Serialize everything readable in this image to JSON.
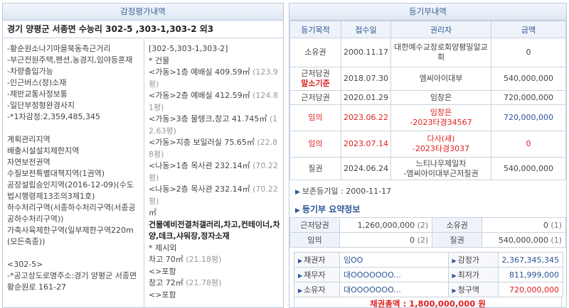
{
  "appraisal": {
    "header": "감정평가내역",
    "address": "경기 양평군 서종면 수능리 302-5 ,303-1,303-2 외3",
    "left_lines": [
      "-황순원소나기마을북동측근거리",
      "-부근전원주택,펜션,농경지,임야등혼재",
      "-차량출입가능",
      "-인근버스(정)소재",
      "-제반교통사정보통",
      "-일단부정형완경사지",
      "-*1차감정:2,359,485,345",
      "",
      "계획관리지역",
      "배출시설설치제한지역",
      "자연보전권역",
      "수질보전특별대책지역(1권역)",
      "공장설립승인지역(2016-12-09)(수도법시행령제13조의3제1호)",
      "하수처리구역(서종하수처리구역(서종공공하수처리구역))",
      "가축사육제한구역(일부제한구역220m(모든축종))",
      "",
      "<302-5>",
      "-*공고상도로명주소:경기 양평군 서종면 황순원로 161-27"
    ],
    "right_items": [
      {
        "text": "[302-5,303-1,303-2]",
        "sub": ""
      },
      {
        "text": "* 건물",
        "sub": ""
      },
      {
        "text": "<가동>1층 예배실 409.59㎡",
        "sub": "(123.9평)"
      },
      {
        "text": "<가동>2층 예배실 412.59㎡",
        "sub": "(124.81평)"
      },
      {
        "text": "<가동>3층 물탱크,창고 41.745㎡",
        "sub": "(12.63평)"
      },
      {
        "text": "<가동>지층 보일러실 75.65㎡",
        "sub": "(22.88평)"
      },
      {
        "text": "<나동>1층 목사관 232.14㎡",
        "sub": "(70.22평)"
      },
      {
        "text": "<나동>2층 목사관 232.14㎡",
        "sub": "(70.22평)"
      },
      {
        "text": "㎡",
        "sub": ""
      },
      {
        "text": "건물예비전결처갤러리,차고,컨테이너,차양,데크,샤워장,정자소재",
        "sub": "",
        "bold": true
      },
      {
        "text": "* 제시외",
        "sub": ""
      },
      {
        "text": "차고 70㎡",
        "sub": "(21.18평)"
      },
      {
        "text": "<>포함",
        "sub": ""
      },
      {
        "text": "창고 72㎡",
        "sub": "(21.78평)"
      },
      {
        "text": "<>포함",
        "sub": ""
      }
    ]
  },
  "registry": {
    "header": "등기부내역",
    "columns": [
      "등기목적",
      "접수일",
      "권리자",
      "금액"
    ],
    "rows": [
      {
        "purpose": "소유권",
        "note": "",
        "date": "2000.11.17",
        "holder": "대한예수교장로회양평밀알교회",
        "amount": "0",
        "red": false
      },
      {
        "purpose": "근저당권",
        "note": "말소기준",
        "date": "2018.07.30",
        "holder": "엠씨아이대부",
        "amount": "540,000,000",
        "red": false
      },
      {
        "purpose": "근저당권",
        "note": "",
        "date": "2020.01.29",
        "holder": "임창은",
        "amount": "720,000,000",
        "red": false
      },
      {
        "purpose": "임의",
        "note": "",
        "date": "2023.06.22",
        "holder": "임창은\n-2023타경34567",
        "amount": "720,000,000",
        "red": true
      },
      {
        "purpose": "임의",
        "note": "",
        "date": "2023.07.14",
        "holder": "다사(새)\n-2023타경3037",
        "amount": "0",
        "red": true
      },
      {
        "purpose": "질권",
        "note": "",
        "date": "2024.06.24",
        "holder": "느티나무제일차\n-엠씨아이대부근저질권",
        "amount": "540,000,000",
        "red": false
      }
    ],
    "preserve_date": "보존등기일 : 2000-11-17",
    "summary_title": "등기부 요약정보",
    "summary": [
      {
        "k1": "근저당권",
        "v1": "1,260,000,000",
        "c1": "(2)",
        "k2": "소유권",
        "v2": "0",
        "c2": "(1)"
      },
      {
        "k1": "임의",
        "v1": "0",
        "c1": "(2)",
        "k2": "질권",
        "v2": "540,000,000",
        "c2": "(1)"
      }
    ],
    "parties": [
      {
        "k": "채권자",
        "v": "임OO",
        "k2": "감정가",
        "v2": "2,367,345,345",
        "red": false
      },
      {
        "k": "채무자",
        "v": "대OOOOOOO...",
        "k2": "최저가",
        "v2": "811,999,000",
        "red": false
      },
      {
        "k": "소유자",
        "v": "대OOOOOOO...",
        "k2": "청구액",
        "v2": "720,000,000",
        "red": true
      }
    ],
    "total": "채권총액 : 1,800,000,000 원"
  }
}
